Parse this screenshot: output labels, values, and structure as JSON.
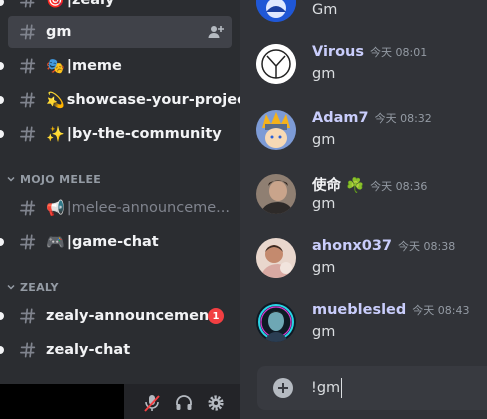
{
  "sidebar": {
    "top_partial": {
      "label": "|zealy",
      "emoji": "🎯"
    },
    "items": [
      {
        "label": "gm",
        "emoji": "",
        "selected": true,
        "muted": false,
        "unread": false
      },
      {
        "label": "|meme",
        "emoji": "🎭",
        "selected": false,
        "muted": false,
        "unread": true
      },
      {
        "label": "showcase-your-project",
        "emoji": "💫",
        "selected": false,
        "muted": false,
        "unread": true
      },
      {
        "label": "|by-the-community",
        "emoji": "✨",
        "selected": false,
        "muted": false,
        "unread": true
      }
    ],
    "categories": [
      {
        "name": "MOJO MELEE",
        "items": [
          {
            "label": "|melee-announceme...",
            "emoji": "📢",
            "muted": true,
            "unread": false
          },
          {
            "label": "|game-chat",
            "emoji": "🎮",
            "muted": false,
            "unread": true
          }
        ]
      },
      {
        "name": "ZEALY",
        "items": [
          {
            "label": "zealy-announcement",
            "badge": "1",
            "muted": false,
            "unread": true
          },
          {
            "label": "zealy-chat",
            "muted": false,
            "unread": true
          }
        ]
      }
    ]
  },
  "chat": {
    "messages": [
      {
        "user": "",
        "time": "",
        "text": "Gm"
      },
      {
        "user": "Virous",
        "time": "今天 08:01",
        "text": "gm"
      },
      {
        "user": "Adam7",
        "time": "今天 08:32",
        "text": "gm"
      },
      {
        "user": "使命",
        "emoji": "☘️",
        "time": "今天 08:36",
        "text": "gm"
      },
      {
        "user": "ahonx037",
        "time": "今天 08:38",
        "text": "gm"
      },
      {
        "user": "mueblesled",
        "time": "今天 08:43",
        "text": "gm"
      }
    ]
  },
  "composer": {
    "value": "!gm"
  },
  "colors": {
    "accent": "#c9cdfb",
    "sidebar_bg": "#2b2d31",
    "chat_bg": "#313338",
    "badge": "#f23f42"
  },
  "icons": [
    "hash-icon",
    "add-member-icon",
    "chevron-down-icon",
    "mute-mic-icon",
    "headphones-icon",
    "settings-gear-icon",
    "plus-icon"
  ]
}
